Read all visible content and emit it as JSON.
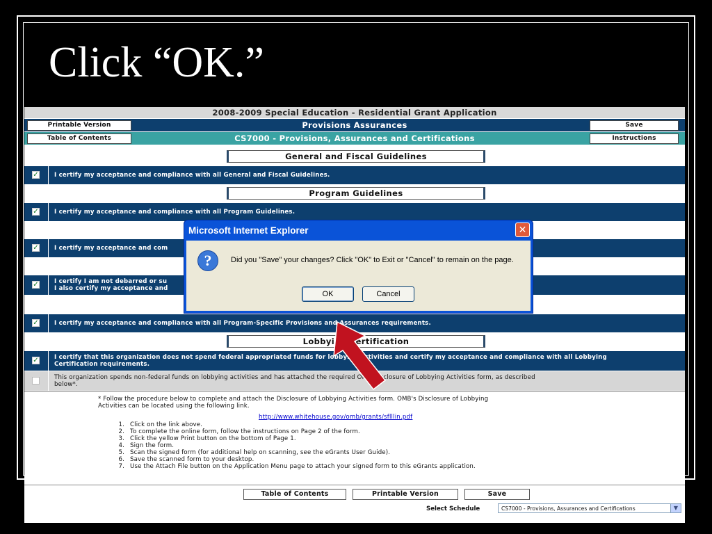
{
  "slide": {
    "title": "Click “OK.”"
  },
  "app": {
    "header_title": "2008-2009 Special Education - Residential Grant Application",
    "printable_label": "Printable Version",
    "section_title": "Provisions Assurances",
    "save_label": "Save",
    "toc_label": "Table of Contents",
    "form_title": "CS7000 - Provisions, Assurances and Certifications",
    "instructions_label": "Instructions",
    "sections": {
      "general": "General and Fiscal Guidelines",
      "program": "Program Guidelines",
      "lobbying": "Lobbying Certification"
    },
    "certs": [
      "I certify my acceptance and compliance with all General and Fiscal Guidelines.",
      "I certify my acceptance and compliance with all Program Guidelines.",
      "I certify my acceptance and compliance with all Program-Specific Provisions and Assurances requirements.",
      "I certify that this organization does not spend federal appropriated funds for lobbying activities and certify my acceptance and compliance with all Lobbying\nCertification requirements.",
      "This organization spends non-federal funds on lobbying activities and has attached the required OMB Disclosure of Lobbying Activities form, as described\nbelow*."
    ],
    "certs_partial": [
      "I certify my acceptance and com",
      "I certify I am not debarred or su\nI also certify my acceptance and"
    ],
    "info": {
      "intro": "* Follow the procedure below to complete and attach the Disclosure of Lobbying Activities form. OMB's Disclosure of Lobbying\n   Activities can be located using the following link.",
      "link": "http://www.whitehouse.gov/omb/grants/sflllin.pdf",
      "steps": [
        {
          "n": "1.",
          "t": "Click on the link above."
        },
        {
          "n": "2.",
          "t": "To complete the online form, follow the instructions on Page 2 of the form."
        },
        {
          "n": "3.",
          "t": "Click the yellow Print button on the bottom of Page 1."
        },
        {
          "n": "4.",
          "t": "Sign the form."
        },
        {
          "n": "5.",
          "t": "Scan the signed form (for additional help on scanning, see the eGrants User Guide)."
        },
        {
          "n": "6.",
          "t": "Save the scanned form to your desktop."
        },
        {
          "n": "7.",
          "t": "Use the Attach File button on the Application Menu page to attach your signed form to this eGrants application."
        }
      ]
    },
    "footer": {
      "toc": "Table of Contents",
      "printable": "Printable Version",
      "save": "Save"
    },
    "schedule": {
      "label": "Select Schedule",
      "value": "CS7000 - Provisions, Assurances and Certifications"
    }
  },
  "dialog": {
    "title": "Microsoft Internet Explorer",
    "message": "Did you \"Save\" your changes? Click \"OK\" to Exit or \"Cancel\" to remain on the page.",
    "ok": "OK",
    "cancel": "Cancel"
  },
  "colors": {
    "navy": "#0d3f6e",
    "teal": "#3aa3a3",
    "arrow": "#c1121f"
  },
  "icons": [
    "checkmark-icon",
    "question-icon",
    "close-icon",
    "chevron-down-icon",
    "arrow-pointer-icon"
  ]
}
